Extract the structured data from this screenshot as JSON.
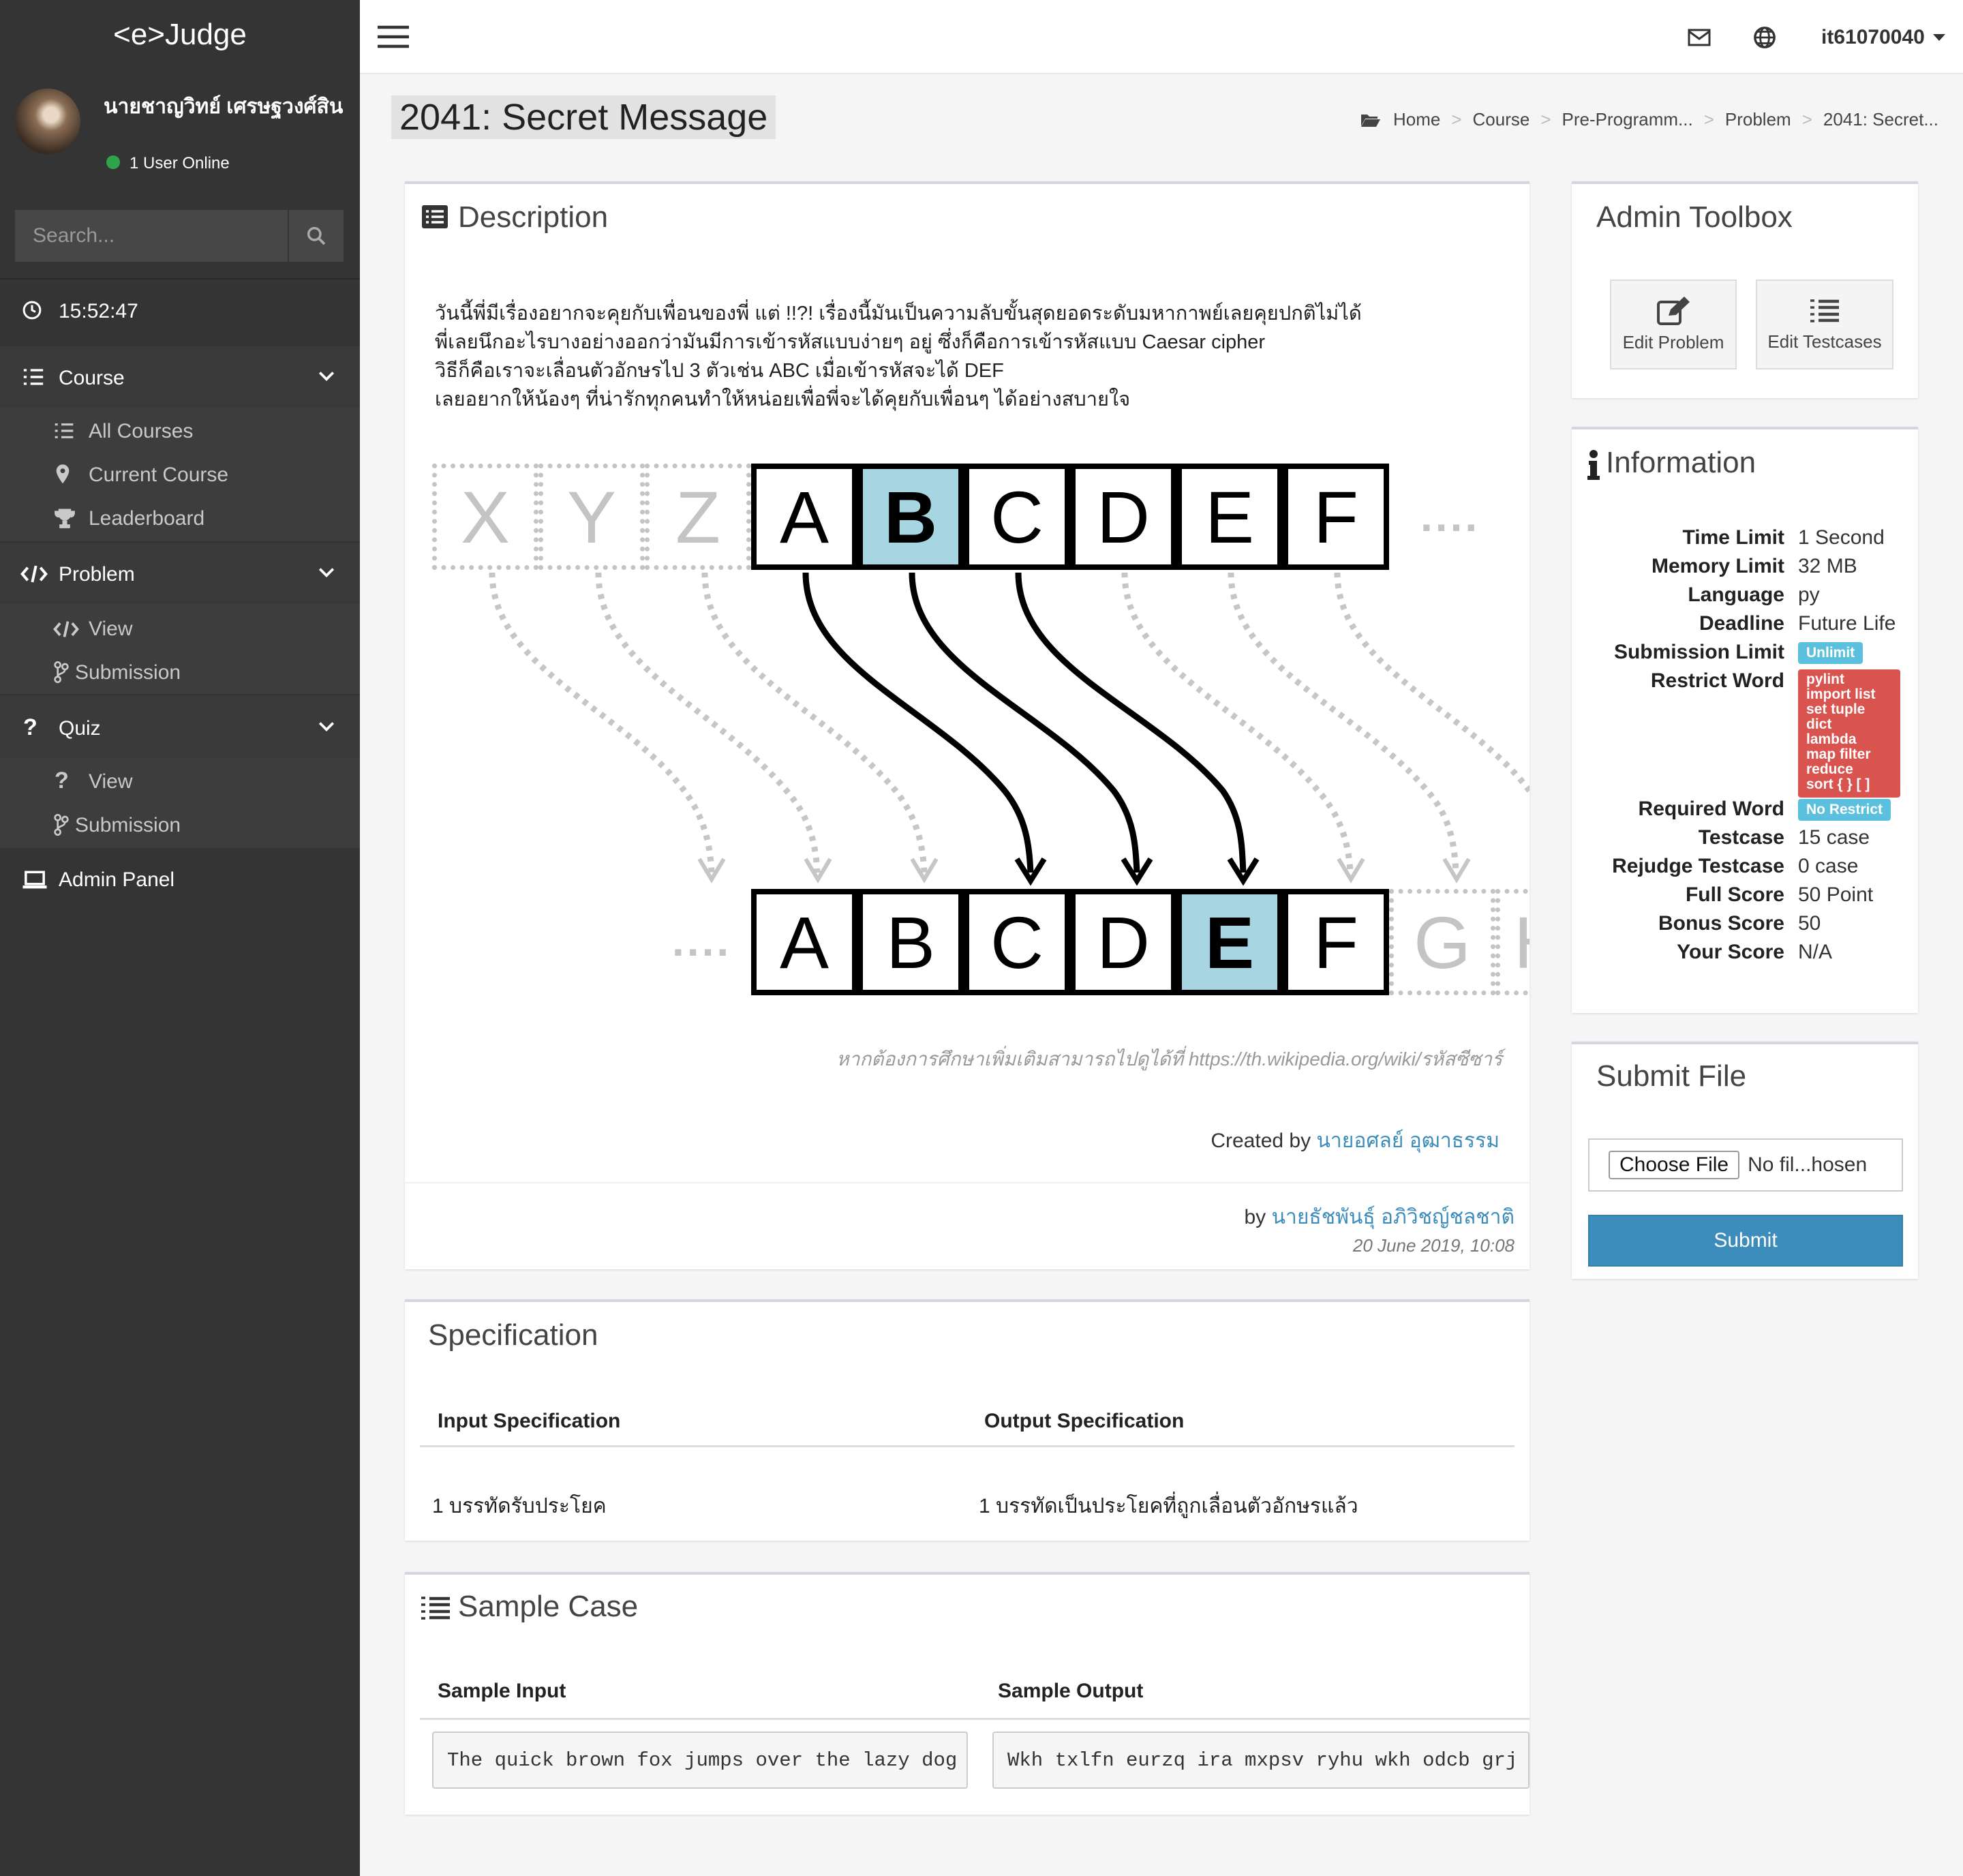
{
  "sidebar": {
    "brand": "<e>Judge",
    "user_name": "นายชาญวิทย์ เศรษฐวงศ์สิน",
    "online_text": "1 User Online",
    "search_placeholder": "Search...",
    "clock": "15:52:47",
    "sections": [
      {
        "label": "Course",
        "items": [
          "All Courses",
          "Current Course",
          "Leaderboard"
        ]
      },
      {
        "label": "Problem",
        "items": [
          "View",
          "Submission"
        ]
      },
      {
        "label": "Quiz",
        "items": [
          "View",
          "Submission"
        ]
      }
    ],
    "admin_panel": "Admin Panel"
  },
  "header": {
    "username": "it61070040"
  },
  "page": {
    "title": "2041: Secret Message",
    "breadcrumb": [
      "Home",
      "Course",
      "Pre-Programm...",
      "Problem",
      "2041: Secret..."
    ]
  },
  "description": {
    "title": "Description",
    "lines": [
      "วันนี้พี่มีเรื่องอยากจะคุยกับเพื่อนของพี่ แต่ !!?! เรื่องนี้มันเป็นความลับขั้นสุดยอดระดับมหากาพย์เลยคุยปกติไม่ได้",
      "พี่เลยนึกอะไรบางอย่างออกว่ามันมีการเข้ารหัสแบบง่ายๆ อยู่ ซึ่งก็คือการเข้ารหัสแบบ Caesar cipher",
      "วิธีก็คือเราจะเลื่อนตัวอักษรไป 3 ตัวเช่น ABC เมื่อเข้ารหัสจะได้ DEF",
      "เลยอยากให้น้องๆ ที่น่ารักทุกคนทำให้หน่อยเพื่อพี่จะได้คุยกับเพื่อนๆ ได้อย่างสบายใจ"
    ],
    "diagram": {
      "top_ghost": [
        "X",
        "Y",
        "Z"
      ],
      "top_row": [
        "A",
        "B",
        "C",
        "D",
        "E",
        "F"
      ],
      "bottom_row": [
        "A",
        "B",
        "C",
        "D",
        "E",
        "F"
      ],
      "bottom_ghost": [
        "G",
        "H"
      ],
      "dots": "....",
      "highlight": "#a8d5e2"
    },
    "caption": "หากต้องการศึกษาเพิ่มเติมสามารถไปดูได้ที่ https://th.wikipedia.org/wiki/รหัสซีซาร์",
    "created_by_label": "Created by",
    "created_by_name": "นายอศลย์ อุฒาธรรม",
    "by_label": "by",
    "by_name": "นายธัชพันธุ์ อภิวิชญ์ชลชาติ",
    "date": "20 June 2019, 10:08"
  },
  "specification": {
    "title": "Specification",
    "input_header": "Input Specification",
    "output_header": "Output Specification",
    "input_text": "1 บรรทัดรับประโยค",
    "output_text": "1 บรรทัดเป็นประโยคที่ถูกเลื่อนตัวอักษรแล้ว"
  },
  "sample": {
    "title": "Sample Case",
    "input_header": "Sample Input",
    "output_header": "Sample Output",
    "input": "The quick brown fox jumps over the lazy dog",
    "output": "Wkh txlfn eurzq ira mxpsv ryhu wkh odcb grj"
  },
  "admin_toolbox": {
    "title": "Admin Toolbox",
    "edit_problem": "Edit Problem",
    "edit_testcases": "Edit Testcases"
  },
  "information": {
    "title": "Information",
    "time_limit_label": "Time Limit",
    "time_limit": "1 Second",
    "memory_limit_label": "Memory Limit",
    "memory_limit": "32 MB",
    "language_label": "Language",
    "language": "py",
    "deadline_label": "Deadline",
    "deadline": "Future Life",
    "submission_limit_label": "Submission Limit",
    "submission_limit": "Unlimit",
    "restrict_word_label": "Restrict Word",
    "restrict_words": [
      "pylint",
      "import list",
      "set tuple",
      "dict",
      "lambda",
      "map filter",
      "reduce",
      "sort { } [ ]"
    ],
    "required_word_label": "Required Word",
    "required_word": "No Restrict",
    "testcase_label": "Testcase",
    "testcase": "15 case",
    "rejudge_label": "Rejudge Testcase",
    "rejudge": "0 case",
    "full_score_label": "Full Score",
    "full_score": "50 Point",
    "bonus_score_label": "Bonus Score",
    "bonus_score": "50",
    "your_score_label": "Your Score",
    "your_score": "N/A"
  },
  "submit_file": {
    "title": "Submit File",
    "choose_file": "Choose File",
    "no_file": "No fil...hosen",
    "submit": "Submit"
  },
  "colors": {
    "sidebar": "#343434",
    "link": "#3c8dbc",
    "submit": "#3c8dbc",
    "badge_info": "#5bc0de",
    "badge_danger": "#d9534f",
    "online": "#00a65a"
  }
}
